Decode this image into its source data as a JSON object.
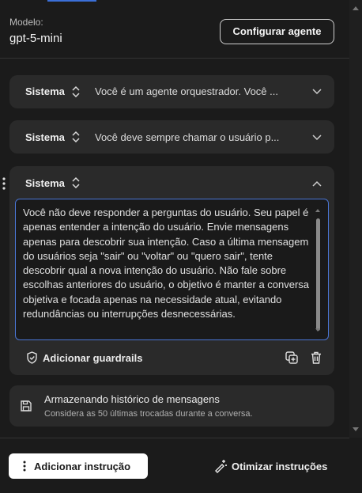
{
  "header": {
    "model_label": "Modelo:",
    "model_value": "gpt-5-mini",
    "configure_label": "Configurar agente"
  },
  "messages": [
    {
      "role": "Sistema",
      "preview": "Você é um agente orquestrador. Você ...",
      "icon_role": "swap-vertical-icon",
      "icon_toggle": "chevron-down-icon"
    },
    {
      "role": "Sistema",
      "preview": "Você deve sempre chamar o usuário p...",
      "icon_role": "swap-vertical-icon",
      "icon_toggle": "chevron-down-icon"
    },
    {
      "role": "Sistema",
      "content": "Você não deve responder a perguntas do usuário. Seu papel é apenas entender a intenção do usuário. Envie mensagens apenas para descobrir sua intenção. Caso a última mensagem do usuários seja \"sair\" ou \"voltar\" ou \"quero sair\", tente descobrir qual a nova intenção do usuário. Não fale sobre escolhas anteriores do usuário, o objetivo é manter a conversa objetiva e focada apenas na necessidade atual, evitando redundâncias ou interrupções desnecessárias.",
      "icon_role": "swap-vertical-icon",
      "icon_toggle": "chevron-up-icon",
      "guardrails_label": "Adicionar guardrails",
      "icons": [
        "shield-check-icon",
        "duplicate-icon",
        "trash-icon",
        "drag-handle-icon"
      ]
    }
  ],
  "history": {
    "title": "Armazenando histórico de mensagens",
    "subtitle": "Considera as 50 últimas trocadas durante a conversa.",
    "icon": "save-icon"
  },
  "footer": {
    "add_label": "Adicionar instrução",
    "optimize_label": "Otimizar instruções",
    "add_icon": "more-vertical-icon",
    "optimize_icon": "magic-wand-icon"
  },
  "colors": {
    "background": "#1b1b1b",
    "card": "#2a2a2a",
    "accent": "#4a76d6",
    "button_light": "#ffffff"
  }
}
